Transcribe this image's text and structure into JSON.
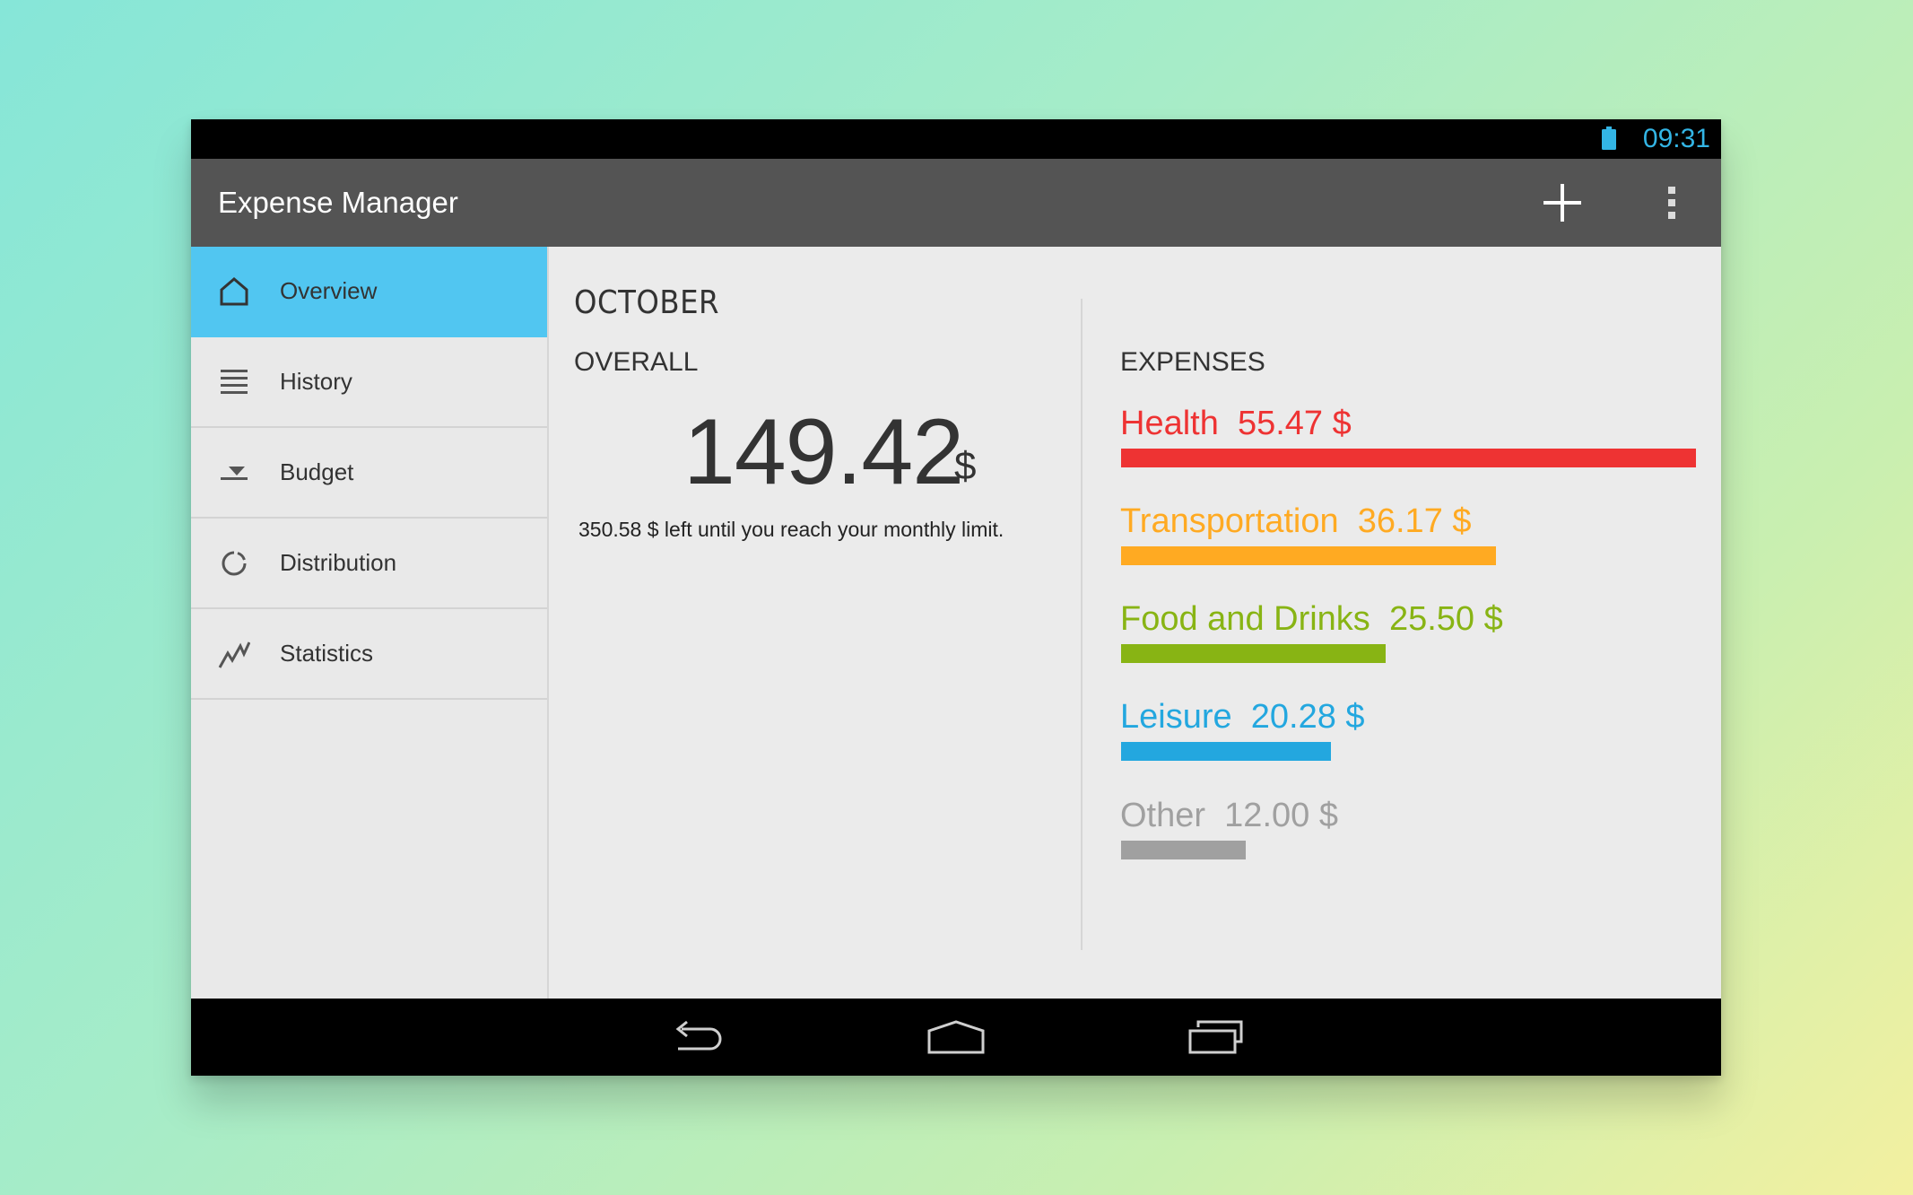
{
  "status_bar": {
    "time": "09:31"
  },
  "app": {
    "title": "Expense Manager"
  },
  "sidebar": {
    "items": [
      {
        "label": "Overview",
        "icon": "home-icon",
        "active": true
      },
      {
        "label": "History",
        "icon": "list-icon"
      },
      {
        "label": "Budget",
        "icon": "budget-icon"
      },
      {
        "label": "Distribution",
        "icon": "distribution-icon"
      },
      {
        "label": "Statistics",
        "icon": "statistics-icon"
      }
    ]
  },
  "overview": {
    "month": "OCTOBER",
    "overall_title": "OVERALL",
    "amount": "149.42",
    "currency": "$",
    "limit_text": "350.58 $ left until you reach your monthly limit."
  },
  "expenses": {
    "title": "EXPENSES",
    "items": [
      {
        "name": "Health",
        "amount": "55.47 $",
        "value": 55.47,
        "color": "#ee3333"
      },
      {
        "name": "Transportation",
        "amount": "36.17 $",
        "value": 36.17,
        "color": "#ffaa22"
      },
      {
        "name": "Food and Drinks",
        "amount": "25.50 $",
        "value": 25.5,
        "color": "#88b414"
      },
      {
        "name": "Leisure",
        "amount": "20.28 $",
        "value": 20.28,
        "color": "#23a7df"
      },
      {
        "name": "Other",
        "amount": "12.00 $",
        "value": 12.0,
        "color": "#a0a0a0"
      }
    ]
  },
  "colors": {
    "accent": "#51c6f1",
    "status_clock": "#33b5e5",
    "action_bar": "#545454"
  }
}
